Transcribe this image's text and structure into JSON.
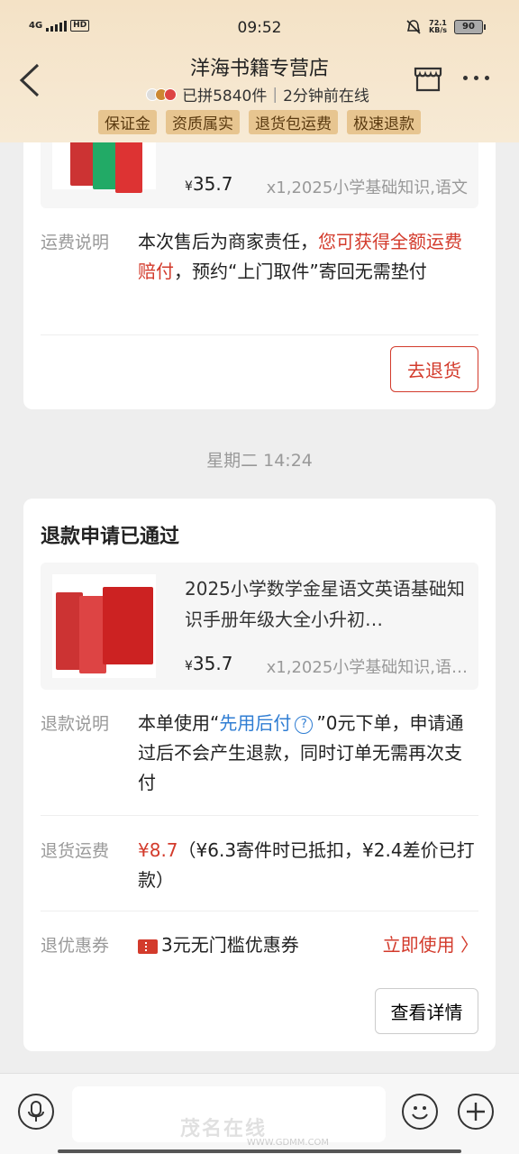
{
  "status_bar": {
    "network": "4G",
    "hd": "HD",
    "time": "09:52",
    "speed_value": "72.1",
    "speed_unit": "KB/s",
    "battery": "90"
  },
  "header": {
    "title": "洋海书籍专营店",
    "sold": "已拼5840件",
    "online": "2分钟前在线",
    "tags": [
      "保证金",
      "资质属实",
      "退货包运费",
      "极速退款"
    ]
  },
  "card1": {
    "product": {
      "price_symbol": "¥",
      "price": "35.7",
      "spec": "x1,2025小学基础知识,语文"
    },
    "freight_label": "运费说明",
    "freight_text_a": "本次售后为商家责任，",
    "freight_text_red": "您可获得全额运费赔付",
    "freight_text_b": "，预约“上门取件”寄回无需垫付",
    "button": "去退货"
  },
  "time_divider": "星期二 14:24",
  "card2": {
    "title": "退款申请已通过",
    "product": {
      "name": "2025小学数学金星语文英语基础知识手册年级大全小升初…",
      "price_symbol": "¥",
      "price": "35.7",
      "spec": "x1,2025小学基础知识,语…"
    },
    "refund_label": "退款说明",
    "refund_a": "本单使用“",
    "refund_blue": "先用后付",
    "refund_q": "?",
    "refund_b": "”0元下单，申请通过后不会产生退款，同时订单无需再次支付",
    "return_fee_label": "退货运费",
    "return_fee_red": "¥8.7",
    "return_fee_text": "（¥6.3寄件时已抵扣，¥2.4差价已打款）",
    "coupon_label": "退优惠券",
    "coupon_text": "3元无门槛优惠券",
    "coupon_action": "立即使用 〉",
    "button": "查看详情"
  },
  "watermark": {
    "main": "茂名在线",
    "url": "WWW.GDMM.COM"
  }
}
